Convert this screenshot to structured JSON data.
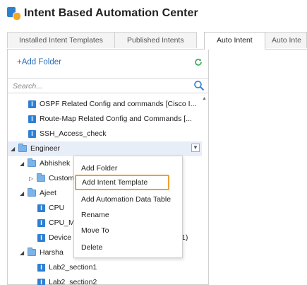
{
  "app": {
    "title": "Intent Based Automation Center"
  },
  "tabs": [
    {
      "label": "Installed Intent Templates"
    },
    {
      "label": "Published Intents"
    },
    {
      "label": "Auto Intent"
    },
    {
      "label": "Auto Inte"
    }
  ],
  "panel": {
    "add_folder": "+Add Folder",
    "search_placeholder": "Search..."
  },
  "tree": {
    "items": [
      {
        "label": "OSPF Related Config and commands [Cisco I..."
      },
      {
        "label": "Route-Map Related Config and Commands [..."
      },
      {
        "label": "SSH_Access_check"
      },
      {
        "label": "Engineer"
      },
      {
        "label": "Abhishek"
      },
      {
        "label": "Custom"
      },
      {
        "label": "Ajeet"
      },
      {
        "label": "CPU"
      },
      {
        "label": "CPU_M"
      },
      {
        "label": "Device"
      },
      {
        "label": "1)"
      },
      {
        "label": "Harsha"
      },
      {
        "label": "Lab2_section1"
      },
      {
        "label": "Lab2_section2"
      }
    ],
    "intent_badge": "I"
  },
  "context_menu": {
    "items": [
      {
        "label": "Add Folder"
      },
      {
        "label": "Add Intent Template"
      },
      {
        "label": "Add Automation Data Table"
      },
      {
        "label": "Rename"
      },
      {
        "label": "Move To"
      },
      {
        "label": "Delete"
      }
    ],
    "highlighted_index": 1
  },
  "colors": {
    "accent": "#2f80d4",
    "highlight_border": "#f0a030",
    "link": "#2c6eb6"
  }
}
